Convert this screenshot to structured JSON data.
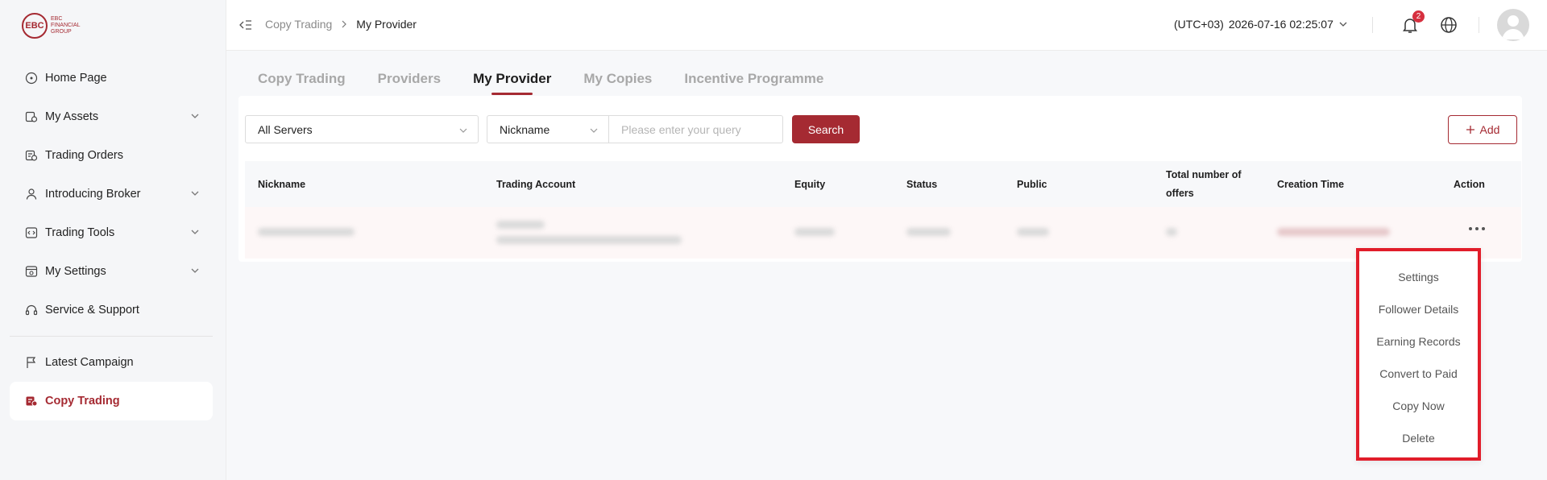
{
  "brand": {
    "logo_mark": "EBC",
    "logo_lines": [
      "EBC",
      "FINANCIAL",
      "GROUP"
    ]
  },
  "sidebar": {
    "items": [
      {
        "label": "Home Page",
        "icon": "home-icon",
        "expandable": false
      },
      {
        "label": "My Assets",
        "icon": "assets-icon",
        "expandable": true
      },
      {
        "label": "Trading Orders",
        "icon": "orders-icon",
        "expandable": false
      },
      {
        "label": "Introducing Broker",
        "icon": "broker-icon",
        "expandable": true
      },
      {
        "label": "Trading Tools",
        "icon": "tools-icon",
        "expandable": true
      },
      {
        "label": "My Settings",
        "icon": "settings-icon",
        "expandable": true
      },
      {
        "label": "Service & Support",
        "icon": "headset-icon",
        "expandable": false
      }
    ],
    "secondary": [
      {
        "label": "Latest Campaign",
        "icon": "flag-icon"
      },
      {
        "label": "Copy Trading",
        "icon": "copy-trading-icon",
        "active": true
      }
    ]
  },
  "header": {
    "breadcrumb": {
      "parent": "Copy Trading",
      "current": "My Provider"
    },
    "timezone": "(UTC+03)",
    "datetime": "2026-07-16 02:25:07",
    "notification_count": "2"
  },
  "tabs": [
    {
      "label": "Copy Trading",
      "active": false
    },
    {
      "label": "Providers",
      "active": false
    },
    {
      "label": "My Provider",
      "active": true
    },
    {
      "label": "My Copies",
      "active": false
    },
    {
      "label": "Incentive Programme",
      "active": false
    }
  ],
  "filters": {
    "server_select": "All Servers",
    "field_select": "Nickname",
    "query_placeholder": "Please enter your query",
    "search_label": "Search",
    "add_label": "Add"
  },
  "table": {
    "columns": [
      "Nickname",
      "Trading Account",
      "Equity",
      "Status",
      "Public",
      "Total number of offers",
      "Creation Time",
      "Action"
    ]
  },
  "action_menu": {
    "items": [
      "Settings",
      "Follower Details",
      "Earning Records",
      "Convert to Paid",
      "Copy Now",
      "Delete"
    ]
  },
  "colors": {
    "brand": "#a52a32",
    "highlight": "#e11d2a",
    "badge": "#d6303f"
  }
}
